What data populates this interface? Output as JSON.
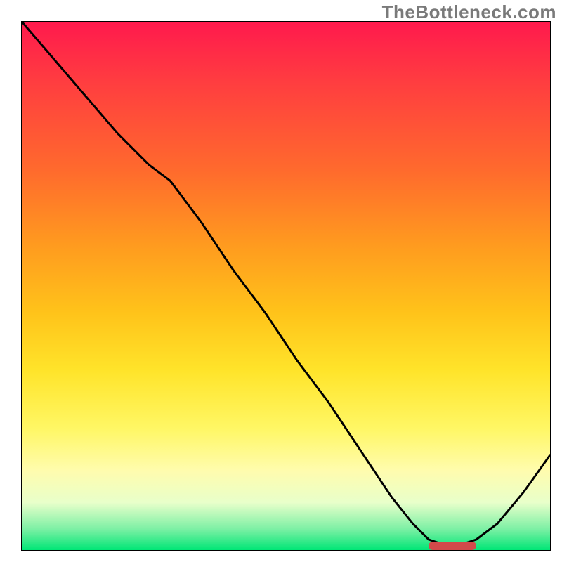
{
  "watermark": "TheBottleneck.com",
  "colors": {
    "frame": "#000000",
    "curve": "#000000",
    "hotzone": "#d24a4a",
    "gradient_top": "#ff1a4d",
    "gradient_bottom": "#00e676"
  },
  "chart_data": {
    "type": "line",
    "title": "",
    "xlabel": "",
    "ylabel": "",
    "xlim": [
      0,
      100
    ],
    "ylim": [
      0,
      100
    ],
    "grid": false,
    "legend": false,
    "series": [
      {
        "name": "bottleneck-curve",
        "x": [
          0,
          6,
          12,
          18,
          24,
          28,
          34,
          40,
          46,
          52,
          58,
          64,
          70,
          74,
          77,
          80,
          83,
          86,
          90,
          95,
          100
        ],
        "y": [
          100,
          93,
          86,
          79,
          73,
          70,
          62,
          53,
          45,
          36,
          28,
          19,
          10,
          5,
          2,
          1,
          1,
          2,
          5,
          11,
          18
        ]
      }
    ],
    "annotations": [
      {
        "name": "optimal-range-bar",
        "x_from": 77,
        "x_to": 86,
        "y": 0.8
      }
    ],
    "background": "vertical-gradient red→orange→yellow→green"
  }
}
